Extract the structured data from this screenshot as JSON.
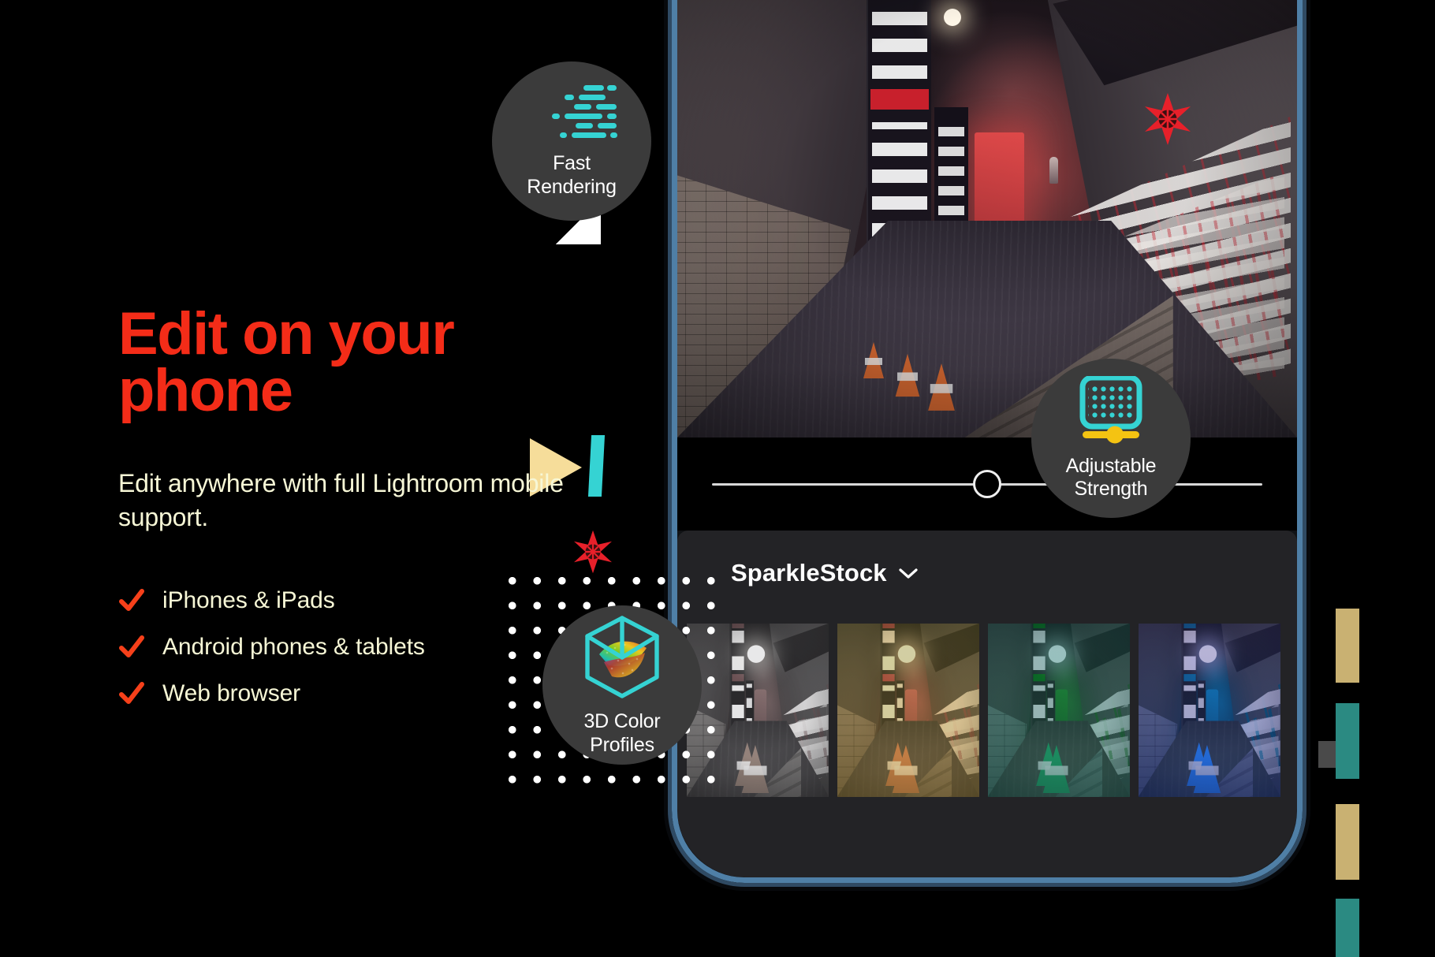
{
  "headline": "Edit on your\nphone",
  "subhead": "Edit anywhere with full Lightroom mobile support.",
  "features": [
    {
      "icon": "check-icon",
      "label": "iPhones & iPads"
    },
    {
      "icon": "check-icon",
      "label": "Android phones & tablets"
    },
    {
      "icon": "check-icon",
      "label": "Web browser"
    }
  ],
  "badges": [
    {
      "id": "fast",
      "label": "Fast\nRendering",
      "icon": "speed-stopwatch-icon"
    },
    {
      "id": "adjust",
      "label": "Adjustable\nStrength",
      "icon": "grid-slider-icon"
    },
    {
      "id": "3d",
      "label": "3D Color\nProfiles",
      "icon": "color-cube-icon"
    }
  ],
  "phone": {
    "slider": {
      "icon": "slider-knob-icon",
      "value_percent": 50
    },
    "presets": {
      "title": "SparkleStock",
      "chevron": "chevron-down-icon",
      "thumbnails": [
        {
          "name": "preset-thumbnail-desaturated",
          "grade": "none"
        },
        {
          "name": "preset-thumbnail-warm",
          "grade": "warm"
        },
        {
          "name": "preset-thumbnail-teal",
          "grade": "teal"
        },
        {
          "name": "preset-thumbnail-blue",
          "grade": "blue"
        }
      ]
    }
  },
  "decorations": {
    "play_triangle": "play-triangle-icon",
    "cyan_bar": "cyan-bar-shape",
    "dot_grid": "dot-grid-pattern",
    "stars": [
      "star-burst-icon",
      "star-burst-icon"
    ]
  },
  "colors": {
    "background": "#000000",
    "headline_red": "#f42c18",
    "body_cream": "#f7f7d6",
    "check_orange": "#f6401a",
    "accent_cyan": "#35d3d3",
    "accent_yellow": "#f4c312",
    "badge_gray": "#3b3b3b",
    "star_red": "#e8202a",
    "play_yellow": "#f6dd9a",
    "chip_gold": "#c9b172",
    "chip_teal": "#2b8a82",
    "phone_rim_blue": "#4f7fa6"
  }
}
